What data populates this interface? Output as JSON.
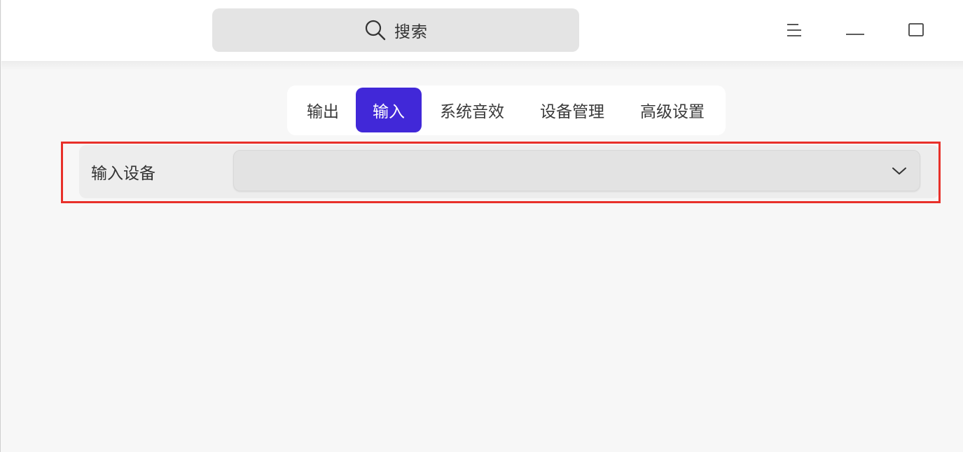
{
  "header": {
    "search": {
      "label": "搜索",
      "icon": "search-icon"
    },
    "window_controls": [
      {
        "name": "menu",
        "icon": "menu-icon"
      },
      {
        "name": "minimize",
        "icon": "minimize-icon"
      },
      {
        "name": "maximize",
        "icon": "maximize-icon"
      }
    ]
  },
  "tabs": [
    {
      "label": "输出",
      "active": false
    },
    {
      "label": "输入",
      "active": true
    },
    {
      "label": "系统音效",
      "active": false
    },
    {
      "label": "设备管理",
      "active": false
    },
    {
      "label": "高级设置",
      "active": false
    }
  ],
  "input_device": {
    "label": "输入设备",
    "selected_value": ""
  },
  "colors": {
    "accent": "#4128d8",
    "highlight_border": "#e8302a"
  }
}
